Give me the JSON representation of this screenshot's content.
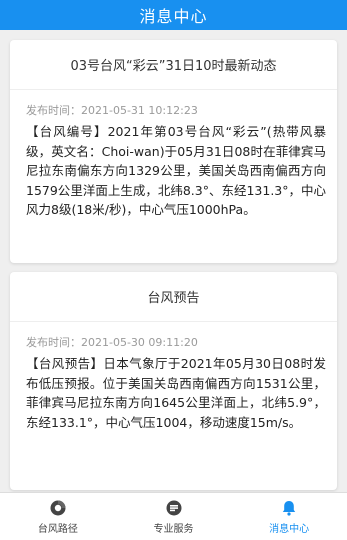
{
  "header": {
    "title": "消息中心"
  },
  "messages": [
    {
      "title": "03号台风“彩云”31日10时最新动态",
      "time_label": "发布时间：",
      "time": "2021-05-31 10:12:23",
      "body": "【台风编号】2021年第03号台风“彩云”(热带风暴级，英文名：Choi-wan)于05月31日08时在菲律宾马尼拉东南偏东方向1329公里，美国关岛西南偏西方向1579公里洋面上生成，北纬8.3°、东经131.3°，中心风力8级(18米/秒)，中心气压1000hPa。"
    },
    {
      "title": "台风预告",
      "time_label": "发布时间：",
      "time": "2021-05-30 09:11:20",
      "body": "【台风预告】日本气象厅于2021年05月30日08时发布低压预报。位于美国关岛西南偏西方向1531公里，菲律宾马尼拉东南方向1645公里洋面上，北纬5.9°，东经133.1°，中心气压1004，移动速度15m/s。"
    }
  ],
  "tabbar": {
    "items": [
      {
        "label": "台风路径",
        "icon": "typhoon-path-icon",
        "active": false
      },
      {
        "label": "专业服务",
        "icon": "service-icon",
        "active": false
      },
      {
        "label": "消息中心",
        "icon": "bell-icon",
        "active": true
      }
    ]
  },
  "colors": {
    "accent": "#1890f0",
    "background": "#efefef"
  }
}
